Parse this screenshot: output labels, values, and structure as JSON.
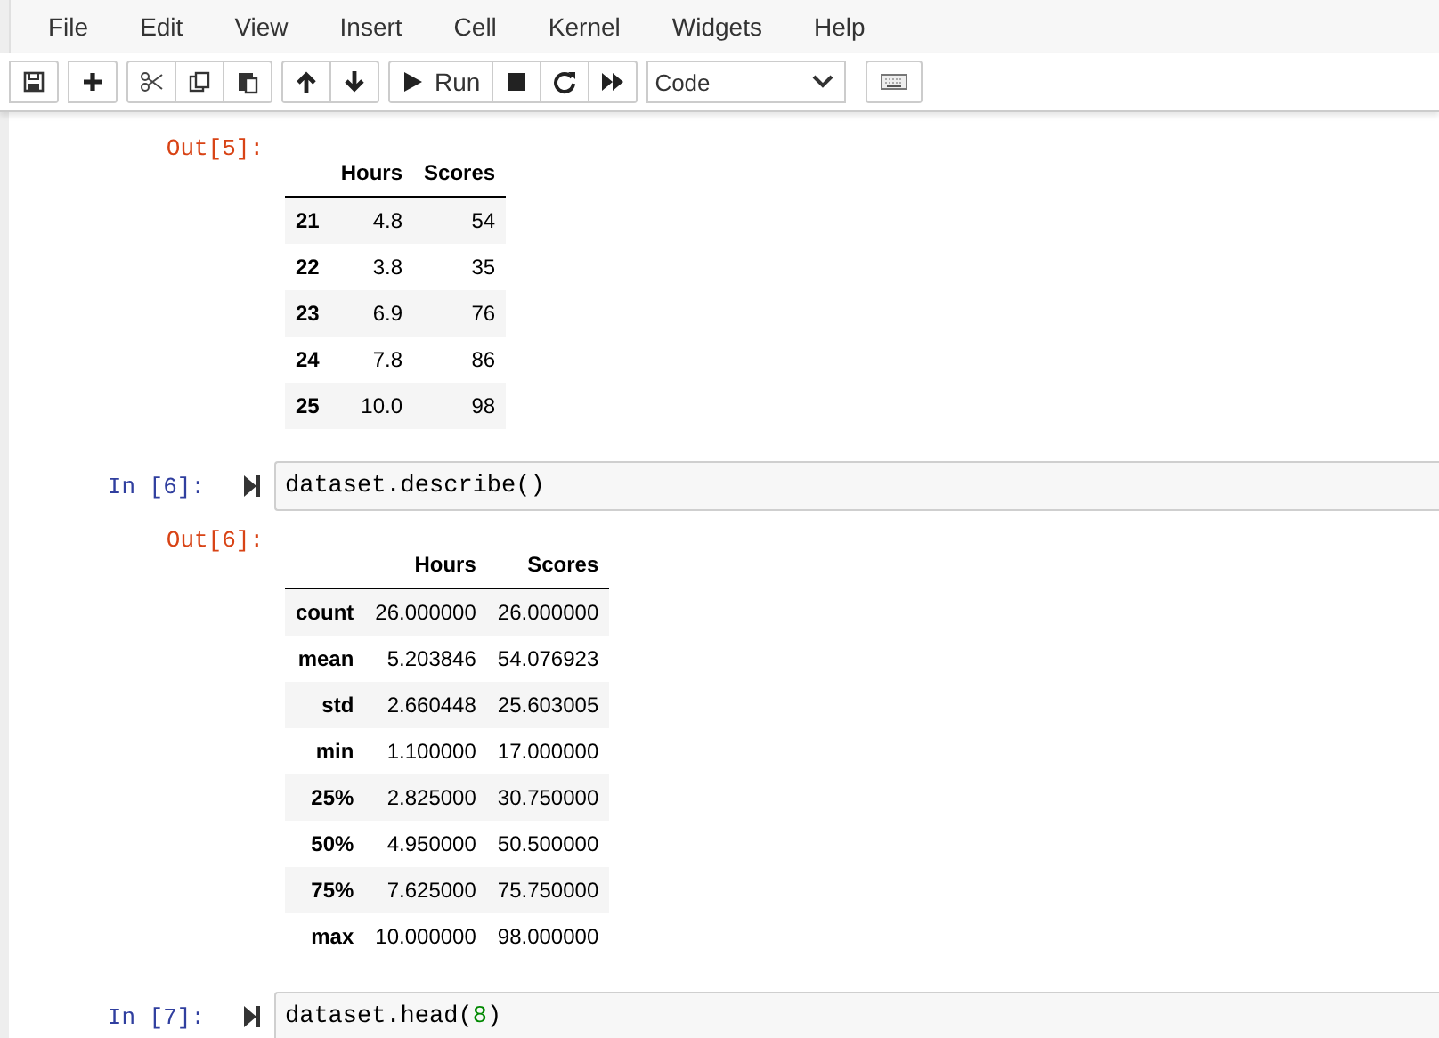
{
  "menu": [
    "File",
    "Edit",
    "View",
    "Insert",
    "Cell",
    "Kernel",
    "Widgets",
    "Help"
  ],
  "toolbar": {
    "groups": [
      [
        {
          "kind": "save"
        }
      ],
      [
        {
          "kind": "insert"
        }
      ],
      [
        {
          "kind": "cut"
        },
        {
          "kind": "copy"
        },
        {
          "kind": "paste"
        }
      ],
      [
        {
          "kind": "move-up"
        },
        {
          "kind": "move-down"
        }
      ],
      [
        {
          "kind": "run",
          "label": "Run"
        },
        {
          "kind": "stop"
        },
        {
          "kind": "restart"
        },
        {
          "kind": "run-all"
        }
      ]
    ],
    "cell_type": "Code",
    "keyboard": {
      "kind": "keyboard"
    }
  },
  "cells": [
    {
      "kind": "output",
      "prompt": "Out[5]:",
      "table": {
        "columns": [
          "Hours",
          "Scores"
        ],
        "rows": [
          {
            "index": "21",
            "cells": [
              "4.8",
              "54"
            ]
          },
          {
            "index": "22",
            "cells": [
              "3.8",
              "35"
            ]
          },
          {
            "index": "23",
            "cells": [
              "6.9",
              "76"
            ]
          },
          {
            "index": "24",
            "cells": [
              "7.8",
              "86"
            ]
          },
          {
            "index": "25",
            "cells": [
              "10.0",
              "98"
            ]
          }
        ]
      }
    },
    {
      "kind": "input",
      "prompt": "In [6]:",
      "code": [
        {
          "kind": "plain",
          "text": "dataset.describe()"
        }
      ]
    },
    {
      "kind": "output",
      "prompt": "Out[6]:",
      "table": {
        "columns": [
          "Hours",
          "Scores"
        ],
        "rows": [
          {
            "index": "count",
            "cells": [
              "26.000000",
              "26.000000"
            ]
          },
          {
            "index": "mean",
            "cells": [
              "5.203846",
              "54.076923"
            ]
          },
          {
            "index": "std",
            "cells": [
              "2.660448",
              "25.603005"
            ]
          },
          {
            "index": "min",
            "cells": [
              "1.100000",
              "17.000000"
            ]
          },
          {
            "index": "25%",
            "cells": [
              "2.825000",
              "30.750000"
            ]
          },
          {
            "index": "50%",
            "cells": [
              "4.950000",
              "50.500000"
            ]
          },
          {
            "index": "75%",
            "cells": [
              "7.625000",
              "75.750000"
            ]
          },
          {
            "index": "max",
            "cells": [
              "10.000000",
              "98.000000"
            ]
          }
        ]
      }
    },
    {
      "kind": "input",
      "prompt": "In [7]:",
      "code": [
        {
          "kind": "plain",
          "text": "dataset.head("
        },
        {
          "kind": "number",
          "text": "8"
        },
        {
          "kind": "plain",
          "text": ")"
        }
      ]
    }
  ]
}
